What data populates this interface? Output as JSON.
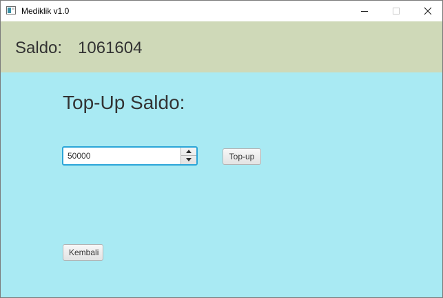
{
  "window": {
    "title": "Mediklik v1.0",
    "icons": [
      "app-icon",
      "minimize-icon",
      "maximize-icon",
      "close-icon"
    ]
  },
  "header": {
    "saldo_label": "Saldo:",
    "saldo_value": "1061604",
    "background": "#cfd9b8"
  },
  "main": {
    "heading": "Top-Up Saldo:",
    "amount_value": "50000",
    "topup_label": "Top-up",
    "back_label": "Kembali",
    "background": "#a9eaf3",
    "focus_color": "#2aa5d8"
  }
}
